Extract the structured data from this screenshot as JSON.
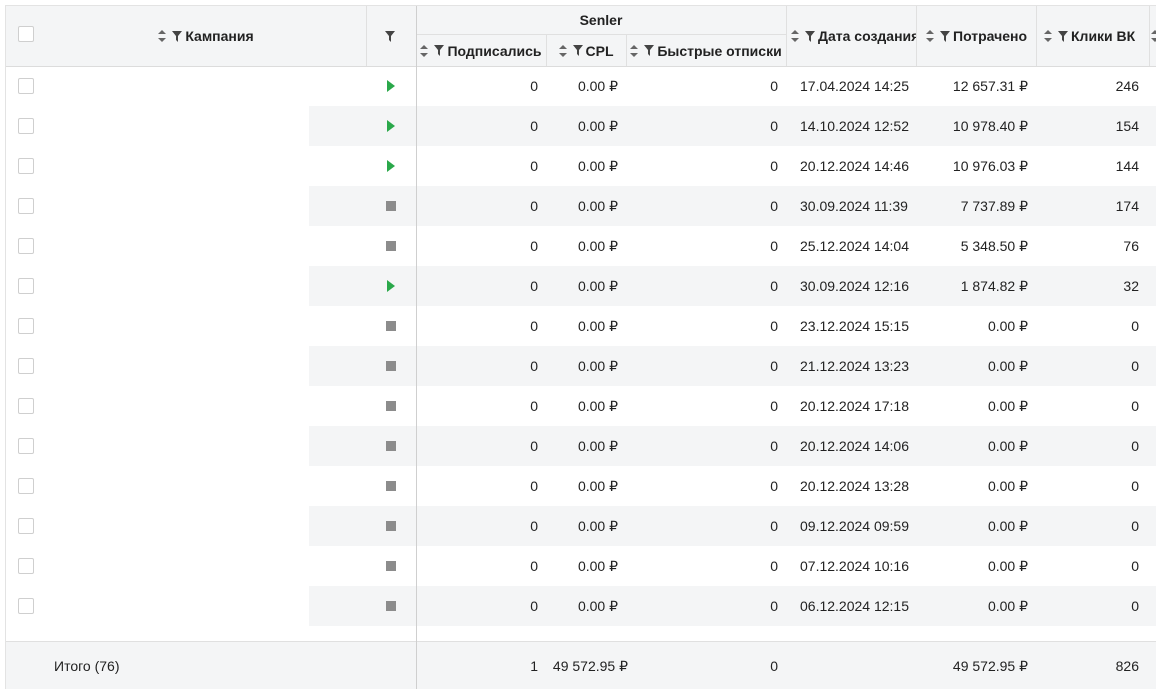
{
  "header": {
    "campaign_label": "Кампания",
    "group_label": "Senler",
    "subscribed_label": "Подписались",
    "cpl_label": "CPL",
    "fast_unsub_label": "Быстрые отписки",
    "created_label": "Дата создания",
    "spent_label": "Потрачено",
    "clicks_label": "Клики ВК"
  },
  "rows": [
    {
      "status": "active",
      "subscribed": "0",
      "cpl": "0.00 ₽",
      "fast_unsub": "0",
      "created": "17.04.2024 14:25",
      "spent": "12 657.31 ₽",
      "clicks": "246"
    },
    {
      "status": "active",
      "subscribed": "0",
      "cpl": "0.00 ₽",
      "fast_unsub": "0",
      "created": "14.10.2024 12:52",
      "spent": "10 978.40 ₽",
      "clicks": "154"
    },
    {
      "status": "active",
      "subscribed": "0",
      "cpl": "0.00 ₽",
      "fast_unsub": "0",
      "created": "20.12.2024 14:46",
      "spent": "10 976.03 ₽",
      "clicks": "144"
    },
    {
      "status": "stopped",
      "subscribed": "0",
      "cpl": "0.00 ₽",
      "fast_unsub": "0",
      "created": "30.09.2024 11:39",
      "spent": "7 737.89 ₽",
      "clicks": "174"
    },
    {
      "status": "stopped",
      "subscribed": "0",
      "cpl": "0.00 ₽",
      "fast_unsub": "0",
      "created": "25.12.2024 14:04",
      "spent": "5 348.50 ₽",
      "clicks": "76"
    },
    {
      "status": "active",
      "subscribed": "0",
      "cpl": "0.00 ₽",
      "fast_unsub": "0",
      "created": "30.09.2024 12:16",
      "spent": "1 874.82 ₽",
      "clicks": "32"
    },
    {
      "status": "stopped",
      "subscribed": "0",
      "cpl": "0.00 ₽",
      "fast_unsub": "0",
      "created": "23.12.2024 15:15",
      "spent": "0.00 ₽",
      "clicks": "0"
    },
    {
      "status": "stopped",
      "subscribed": "0",
      "cpl": "0.00 ₽",
      "fast_unsub": "0",
      "created": "21.12.2024 13:23",
      "spent": "0.00 ₽",
      "clicks": "0"
    },
    {
      "status": "stopped",
      "subscribed": "0",
      "cpl": "0.00 ₽",
      "fast_unsub": "0",
      "created": "20.12.2024 17:18",
      "spent": "0.00 ₽",
      "clicks": "0"
    },
    {
      "status": "stopped",
      "subscribed": "0",
      "cpl": "0.00 ₽",
      "fast_unsub": "0",
      "created": "20.12.2024 14:06",
      "spent": "0.00 ₽",
      "clicks": "0"
    },
    {
      "status": "stopped",
      "subscribed": "0",
      "cpl": "0.00 ₽",
      "fast_unsub": "0",
      "created": "20.12.2024 13:28",
      "spent": "0.00 ₽",
      "clicks": "0"
    },
    {
      "status": "stopped",
      "subscribed": "0",
      "cpl": "0.00 ₽",
      "fast_unsub": "0",
      "created": "09.12.2024 09:59",
      "spent": "0.00 ₽",
      "clicks": "0"
    },
    {
      "status": "stopped",
      "subscribed": "0",
      "cpl": "0.00 ₽",
      "fast_unsub": "0",
      "created": "07.12.2024 10:16",
      "spent": "0.00 ₽",
      "clicks": "0"
    },
    {
      "status": "stopped",
      "subscribed": "0",
      "cpl": "0.00 ₽",
      "fast_unsub": "0",
      "created": "06.12.2024 12:15",
      "spent": "0.00 ₽",
      "clicks": "0"
    }
  ],
  "footer": {
    "total_label": "Итого (76)",
    "subscribed": "1",
    "cpl": "49 572.95 ₽",
    "fast_unsub": "0",
    "spent": "49 572.95 ₽",
    "clicks": "826"
  },
  "colors": {
    "active": "#2aa84a",
    "stopped": "#8c8c8c",
    "band": "#f4f5f6"
  },
  "icons": {
    "sort": "sort-arrows-icon",
    "filter": "funnel-icon",
    "active": "play-icon",
    "stopped": "stop-square-icon"
  }
}
